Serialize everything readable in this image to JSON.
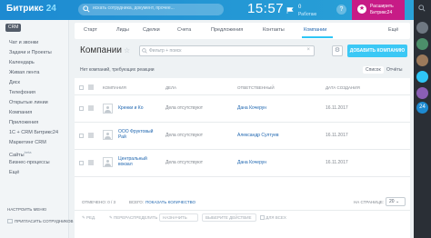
{
  "header": {
    "logo_main": "Битрикс",
    "logo_num": "24",
    "search_placeholder": "искать сотрудника, документ, прочее...",
    "clock": "15:57",
    "tasks_count": "0",
    "tasks_label": "Работаю",
    "help": "?",
    "promo_line1": "Расширить",
    "promo_line2": "Битрикс24"
  },
  "nav": {
    "badge": "CRM",
    "items": [
      {
        "label": "Чат и звонки"
      },
      {
        "label": "Задачи и Проекты"
      },
      {
        "label": "Календарь"
      },
      {
        "label": "Живая лента"
      },
      {
        "label": "Диск"
      },
      {
        "label": "Телефония"
      },
      {
        "label": "Открытые линии"
      },
      {
        "label": "Компания"
      },
      {
        "label": "Приложения"
      },
      {
        "label": "1С + CRM Битрикс24"
      },
      {
        "label": "Маркетинг CRM"
      },
      {
        "label": "Сайты",
        "sup": "beta"
      },
      {
        "label": "Бизнес-процессы"
      },
      {
        "label": "Ещё"
      }
    ],
    "setup_menu": "Настроить меню",
    "invite": "Пригласить сотрудников"
  },
  "tabs": [
    "Старт",
    "Лиды",
    "Сделки",
    "Счета",
    "Предложения",
    "Контакты",
    "Компании",
    "Ещё"
  ],
  "active_tab": "Компании",
  "page": {
    "title": "Компании",
    "filter_placeholder": "Фильтр + поиск",
    "add_button": "Добавить компанию",
    "empty_msg": "Нет компаний, требующих реакции",
    "switch_list": "Список",
    "switch_reports": "Отчёты"
  },
  "table": {
    "columns": [
      "Компания",
      "Дела",
      "Ответственный",
      "Дата создания"
    ],
    "rows": [
      {
        "company": "Кренки и Ко",
        "deals": "Дела отсутствуют",
        "responsible": "Дана Кочерун",
        "date": "16.11.2017"
      },
      {
        "company": "ООО Фруктовый Рай",
        "deals": "Дела отсутствуют",
        "responsible": "Александр Султуев",
        "date": "16.11.2017"
      },
      {
        "company": "Центральный вокзал",
        "deals": "Дела отсутствуют",
        "responsible": "Дана Кочерун",
        "date": "16.11.2017"
      }
    ]
  },
  "footer": {
    "selected": "Отмечено: 0 / 3",
    "total": "Всего:",
    "show_count": "Показать количество",
    "per_page_label": "На странице:",
    "per_page": "20"
  },
  "actions": {
    "edit": "Ред.",
    "recalc": "Перераспределить",
    "assign": "Назначить",
    "choose_action": "Выберите действие",
    "for_all": "Для всех"
  },
  "colors": {
    "header_blue": "#1d8ad1",
    "promo_magenta": "#c71b86",
    "add_button": "#3bc8f5",
    "link": "#2067b0"
  }
}
